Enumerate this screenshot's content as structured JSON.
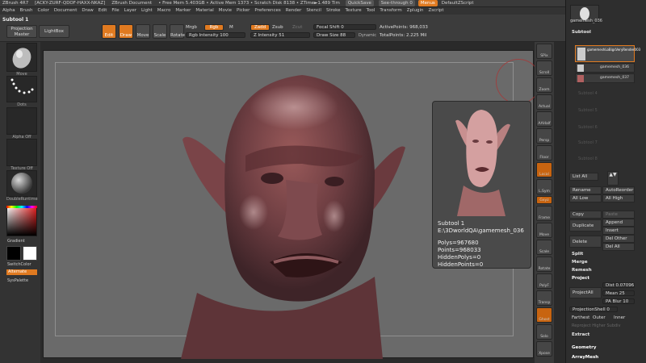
{
  "titlebar": {
    "app": "ZBrush 4R7",
    "license": "[ACKY-ZURF-QDOF-HAXX-NKAZ]",
    "doc": "ZBrush Document",
    "mem": "• Free Mem 5.403GB • Active Mem 1373 • Scratch Disk 8138 • ZTime►1.489 Tim",
    "quicksave": "QuickSave",
    "seethrough": "See-through 0",
    "menus_btn": "Menus",
    "script": "DefaultZScript"
  },
  "menus": [
    "Alpha",
    "Brush",
    "Color",
    "Document",
    "Draw",
    "Edit",
    "File",
    "Layer",
    "Light",
    "Macro",
    "Marker",
    "Material",
    "Movie",
    "Picker",
    "Preferences",
    "Render",
    "Stencil",
    "Stroke",
    "Texture",
    "Tool",
    "Transform",
    "Zplugin",
    "Zscript"
  ],
  "toolbar": {
    "subtool_label": "Subtool 1",
    "projection_master": "Projection Master",
    "lightbox": "LightBox",
    "edit": "Edit",
    "draw": "Draw",
    "move": "Move",
    "scale": "Scale",
    "rotate": "Rotate",
    "mrgb": "Mrgb",
    "rgb": "Rgb",
    "m": "M",
    "rgb_intensity": "Rgb Intensity 100",
    "zadd": "Zadd",
    "zsub": "Zsub",
    "zcut": "Zcut",
    "z_intensity": "Z Intensity 51",
    "focal_shift": "Focal Shift 0",
    "draw_size": "Draw Size 88",
    "dynamic": "Dynamic",
    "active_points": "ActivePoints: 968,033",
    "total_points": "TotalPoints: 2.225 Mil"
  },
  "leftpanel": {
    "brush_caption": "Move",
    "stroke_caption": "Dots",
    "alpha_caption": "Alpha Off",
    "texture_caption": "Texture Off",
    "material_caption": "DoubleRuntime",
    "gradient": "Gradient",
    "switchcolor": "SwitchColor",
    "alternate": "Alternate",
    "sys_palette": "SysPalette"
  },
  "rightstrip": [
    "SPix",
    "Scroll",
    "Zoom",
    "Actual",
    "AAHalf",
    "Persp",
    "Floor",
    "Local",
    "L.Sym",
    "Gxyz",
    "Frame",
    "Move",
    "Scale",
    "Rotate",
    "PolyF",
    "Transp",
    "Ghost",
    "Solo",
    "Xpose"
  ],
  "popup": {
    "line1": "Subtool 1",
    "line2": "E:\\3DworldQA\\gamemesh_036",
    "polys": "Polys=967680",
    "points": "Points=968033",
    "hidden_polys": "HiddenPolys=0",
    "hidden_points": "HiddenPoints=0"
  },
  "rightpanel": {
    "top_caption": "gamemesh_036",
    "subtool_header": "Subtool",
    "subtools": [
      "gamemeshLoBigsVeryRender003",
      "gamemesh_036",
      "gamemesh_037"
    ],
    "ghost_slots": [
      "Subtool 4",
      "Subtool 5",
      "Subtool 6",
      "Subtool 7",
      "Subtool 8"
    ],
    "list_all": "List All",
    "rename": "Rename",
    "autoreorder": "AutoReorder",
    "all_low": "All Low",
    "all_high": "All High",
    "copy": "Copy",
    "paste": "Paste",
    "append": "Append",
    "duplicate": "Duplicate",
    "insert": "Insert",
    "delete": "Delete",
    "del_other": "Del Other",
    "del_all": "Del All",
    "split": "Split",
    "merge": "Merge",
    "remesh": "Remesh",
    "project": "Project",
    "project_all": "ProjectAll",
    "dist": "Dist 0.07096",
    "mean": "Mean 25",
    "pa_blur": "PA Blur 10",
    "projection_shell": "ProjectionShell 0",
    "farthest": "Farthest",
    "outer": "Outer",
    "inner": "Inner",
    "reproject": "Reproject Higher Subdiv",
    "extract": "Extract",
    "geometry": "Geometry",
    "arraymesh": "ArrayMesh"
  },
  "colors": {
    "accent": "#e07a20",
    "viewport_bg": "#6a6a6a",
    "panel_bg": "#333333"
  }
}
